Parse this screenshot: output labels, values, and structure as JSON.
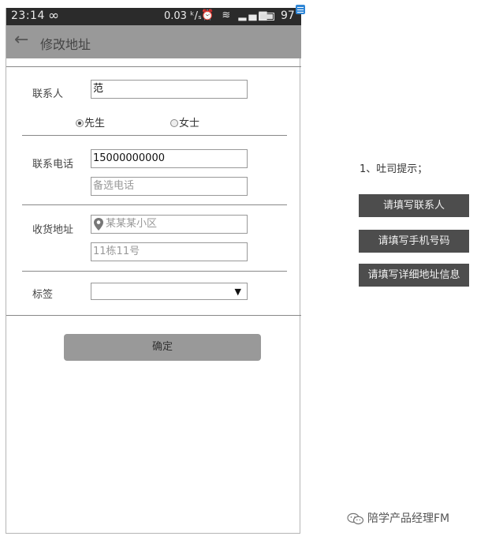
{
  "status_bar": {
    "time": "23:14",
    "infinity": "∞",
    "net_speed": "0.03 ᵏ/ₛ",
    "icons": "⏰ ≋ ▂▄▆",
    "battery_level": "97"
  },
  "header": {
    "back_icon": "←",
    "title": "修改地址"
  },
  "form": {
    "contact_label": "联系人",
    "contact_value": "范",
    "gender_options": [
      "先生",
      "女士"
    ],
    "gender_selected": "先生",
    "phone_label": "联系电话",
    "phone_value": "15000000000",
    "backup_phone_placeholder": "备选电话",
    "address_label": "收货地址",
    "address_placeholder": "某某某小区",
    "detail_placeholder": "11栋11号",
    "tag_label": "标签",
    "tag_value": "",
    "tag_arrow": "▼"
  },
  "confirm_button": "确定",
  "annotation": {
    "note": "1、吐司提示；",
    "toasts": [
      "请填写联系人",
      "请填写手机号码",
      "请填写详细地址信息"
    ]
  },
  "watermark": "陪学产品经理FM",
  "colors": {
    "header_bg": "#999999",
    "statusbar_bg": "#2b2b2b",
    "toast_bg": "#4d4d4d",
    "button_bg": "#999999"
  }
}
